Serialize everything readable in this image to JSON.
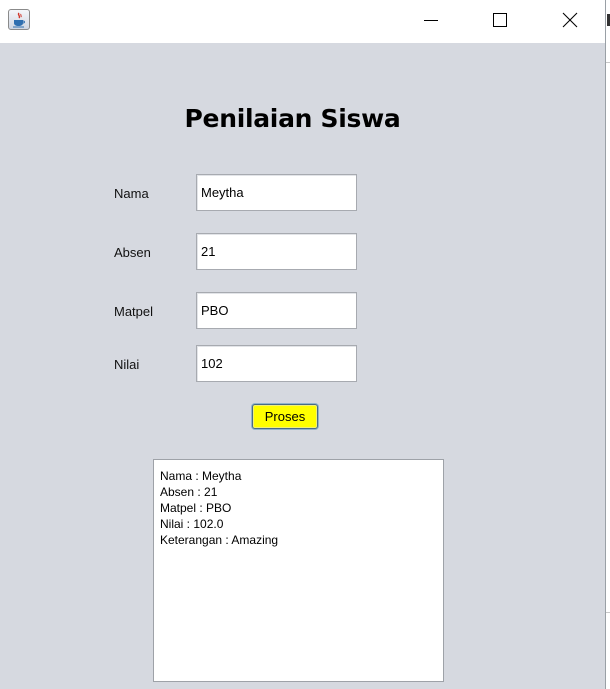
{
  "window": {
    "title": "",
    "icon": "java-icon",
    "controls": [
      "minimize",
      "maximize",
      "close"
    ]
  },
  "form": {
    "title": "Penilaian Siswa",
    "fields": {
      "nama": {
        "label": "Nama",
        "value": "Meytha"
      },
      "absen": {
        "label": "Absen",
        "value": "21"
      },
      "matpel": {
        "label": "Matpel",
        "value": "PBO"
      },
      "nilai": {
        "label": "Nilai",
        "value": "102"
      }
    },
    "button": {
      "label": "Proses",
      "color": "#ffff00"
    }
  },
  "output": {
    "lines": [
      "Nama : Meytha",
      "Absen : 21",
      "Matpel : PBO",
      "Nilai : 102.0",
      "Keterangan : Amazing"
    ]
  },
  "colors": {
    "background": "#d6d9e0",
    "titlebar": "#ffffff",
    "button_border": "#4a6b82"
  }
}
